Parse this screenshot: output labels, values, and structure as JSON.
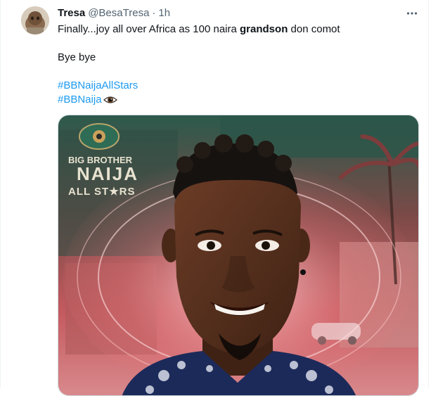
{
  "tweet": {
    "author_name": "Tresa",
    "author_handle": "@BesaTresa",
    "separator": "·",
    "time": "1h",
    "more_icon": "more-dots-icon",
    "text_before_bold": "Finally...joy all over Africa as 100 naira ",
    "text_bold": "grandson",
    "text_after_bold": " don comot",
    "line2": "Bye bye",
    "hashtag1": "#BBNaijaAllStars",
    "hashtag2": "#BBNaija",
    "hashtag2_emoji": "eye-emoji-icon"
  },
  "media": {
    "brand_line1": "BIG BROTHER",
    "brand_line2": "NAIJA",
    "brand_line3": "ALL ST★RS"
  },
  "colors": {
    "link": "#1d9bf0",
    "text": "#0f1419",
    "muted": "#536471",
    "border": "#cfd9de"
  }
}
